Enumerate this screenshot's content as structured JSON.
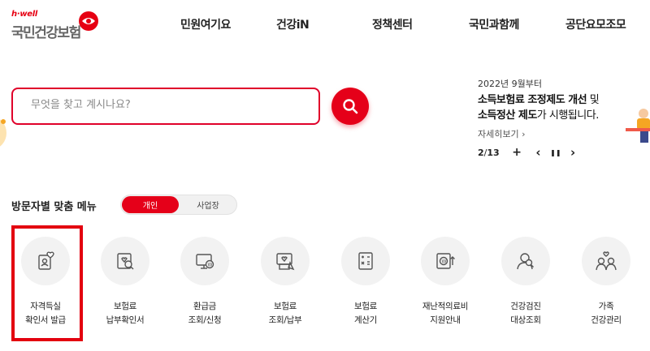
{
  "header": {
    "logo_small": "h·well",
    "logo_text": "국민건강보험",
    "nav": [
      "민원여기요",
      "건강iN",
      "정책센터",
      "국민과함께",
      "공단요모조모"
    ]
  },
  "search": {
    "placeholder": "무엇을 찾고 계시나요?",
    "button_icon": "search-icon"
  },
  "notice": {
    "date": "2022년 9월부터",
    "title_line1_bold": "소득보험료 조정제도 개선",
    "title_line1_plain": " 및",
    "title_line2_bold": "소득정산 제도",
    "title_line2_plain": "가 시행됩니다.",
    "more": "자세히보기 ›",
    "page_current": "2",
    "page_sep": " / ",
    "page_total": "13",
    "add": "+",
    "prev": "‹",
    "pause": "❚❚",
    "next": "›"
  },
  "menu": {
    "title": "방문자별 맞춤 메뉴",
    "toggle_personal": "개인",
    "toggle_business": "사업장",
    "items": [
      {
        "label": "자격득실\n확인서 발급",
        "icon": "certificate-icon"
      },
      {
        "label": "보험료\n납부확인서",
        "icon": "payment-check-icon"
      },
      {
        "label": "환급금\n조회/신청",
        "icon": "refund-icon"
      },
      {
        "label": "보험료\n조회/납부",
        "icon": "premium-inquiry-icon"
      },
      {
        "label": "보험료\n계산기",
        "icon": "calculator-icon"
      },
      {
        "label": "재난적의료비\n지원안내",
        "icon": "medical-cost-icon"
      },
      {
        "label": "건강검진\n대상조회",
        "icon": "health-checkup-icon"
      },
      {
        "label": "가족\n건강관리",
        "icon": "family-icon"
      }
    ]
  },
  "colors": {
    "accent": "#e50019",
    "highlight": "#e3000f"
  }
}
